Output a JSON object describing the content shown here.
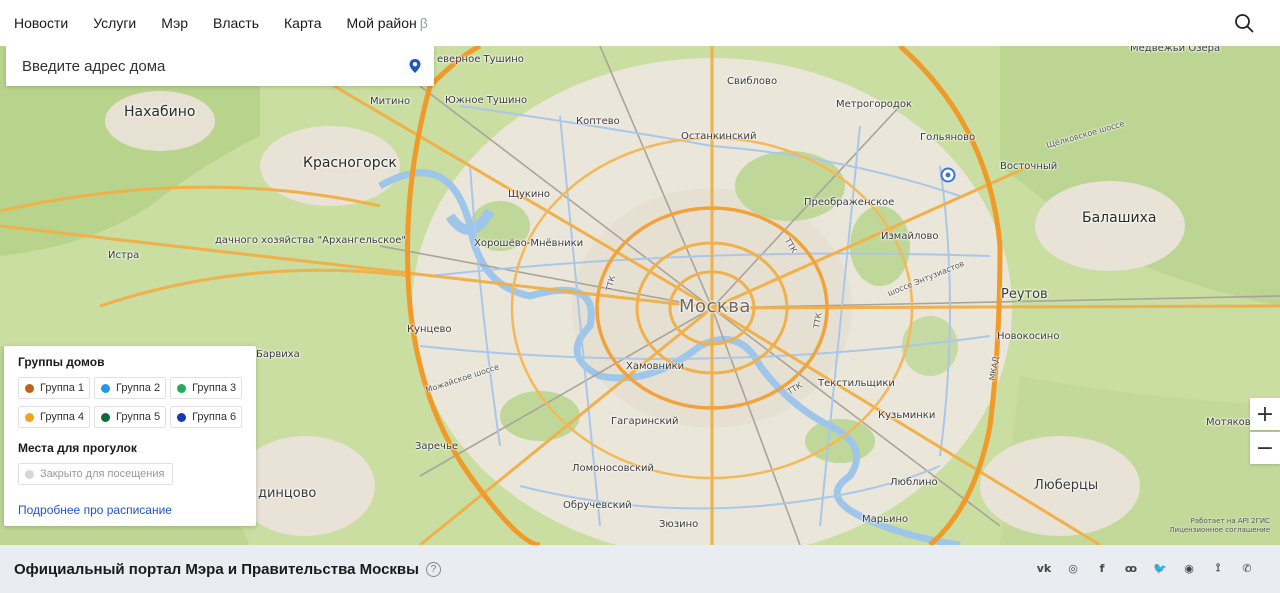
{
  "nav": {
    "items": [
      {
        "label": "Новости"
      },
      {
        "label": "Услуги"
      },
      {
        "label": "Мэр"
      },
      {
        "label": "Власть"
      },
      {
        "label": "Карта"
      },
      {
        "label": "Мой район"
      }
    ],
    "beta_label": "β",
    "search_icon": "search-icon"
  },
  "address": {
    "placeholder": "Введите адрес дома",
    "pin_icon": "location-pin-icon"
  },
  "map": {
    "labels": {
      "moskva": "Москва",
      "nakhabino": "Нахабино",
      "krasnogorsk": "Красногорск",
      "istra": "Истра",
      "arkhangelskoe": "дачного хозяйства \"Архангельское\"",
      "barvikha": "Барвиха",
      "zarechye": "Заречье",
      "odintsovo": "динцово",
      "severnoe_tushino": "еверное Тушино",
      "yuzhnoe_tushino": "Южное Тушино",
      "mitino": "Митино",
      "koptevo": "Коптево",
      "sviblovo": "Свиблово",
      "metrogorodok": "Метрогородок",
      "ostankinsky": "Останкинский",
      "golyanovo": "Гольяново",
      "vostochny": "Восточный",
      "shchukino": "Щукино",
      "preobrazhenskoe": "Преображенское",
      "khoroshevo": "Хорошёво-Мнёвники",
      "izmaylovo": "Измайлово",
      "balashikha": "Балашиха",
      "reutov": "Реутов",
      "novokosino": "Новокосино",
      "kuntsevo": "Кунцево",
      "khamovniki": "Хамовники",
      "tekstilshchiki": "Текстильщики",
      "kuzminki": "Кузьминки",
      "gagarinsky": "Гагаринский",
      "lomonosovsky": "Ломоносовский",
      "obruchevsky": "Обручевский",
      "zyuzino": "Зюзино",
      "lyublino": "Люблино",
      "maryino": "Марьино",
      "lyubertsy": "Люберцы",
      "medvezhi_ozera": "Медвежьи Озера",
      "motyakovo": "Мотяково",
      "shchelkovskoe": "Щёлковское шоссе",
      "entuziastov": "шоссе Энтузиастов",
      "mozhayskoe": "Можайское шоссе",
      "ttk1": "ТТК",
      "ttk2": "ТТК",
      "ttk3": "ТТК",
      "ttk4": "ТТК",
      "mkad": "МКАД"
    },
    "zoom_in": "+",
    "zoom_out": "−",
    "attribution_1": "Работает на API 2ГИС",
    "attribution_2": "Лицензионное соглашение"
  },
  "legend": {
    "houses_title": "Группы домов",
    "groups": [
      {
        "label": "Группа 1",
        "color": "#c0621c"
      },
      {
        "label": "Группа 2",
        "color": "#1e9be8"
      },
      {
        "label": "Группа 3",
        "color": "#1fae5b"
      },
      {
        "label": "Группа 4",
        "color": "#f2a31b"
      },
      {
        "label": "Группа 5",
        "color": "#0f6b36"
      },
      {
        "label": "Группа 6",
        "color": "#1836b8"
      }
    ],
    "walks_title": "Места для прогулок",
    "closed_label": "Закрыто для посещения",
    "closed_color": "#d7d7d7",
    "schedule_link": "Подробнее про расписание"
  },
  "footer": {
    "title": "Официальный портал Мэра и Правительства Москвы",
    "help": "?",
    "social": [
      {
        "icon": "vk-icon",
        "glyph": "vk"
      },
      {
        "icon": "instagram-icon",
        "glyph": "◎"
      },
      {
        "icon": "facebook-icon",
        "glyph": "f"
      },
      {
        "icon": "odnoklassniki-icon",
        "glyph": "ꝏ"
      },
      {
        "icon": "twitter-icon",
        "glyph": "🐦"
      },
      {
        "icon": "livejournal-icon",
        "glyph": "◉"
      },
      {
        "icon": "rss-icon",
        "glyph": "⟟"
      },
      {
        "icon": "phone-icon",
        "glyph": "✆"
      }
    ]
  }
}
